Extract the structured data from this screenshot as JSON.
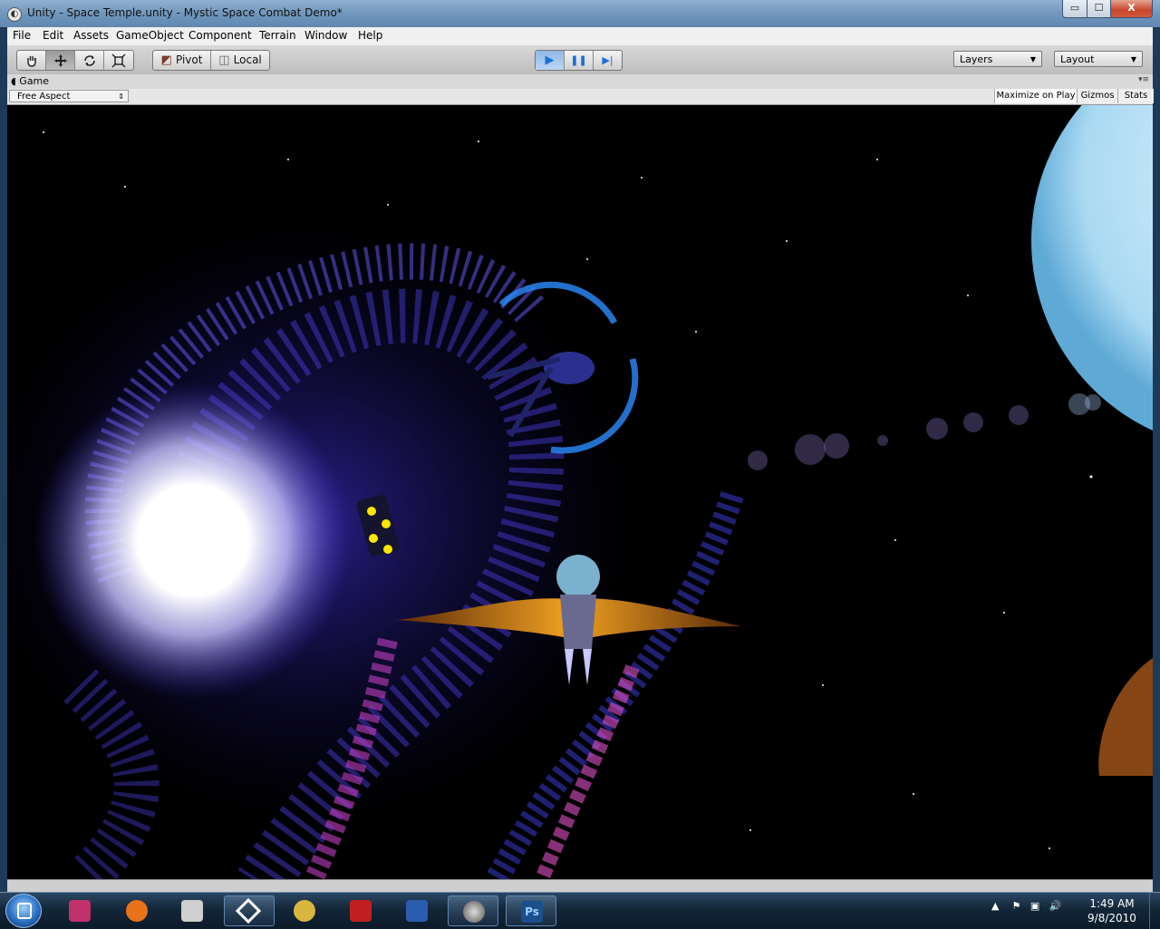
{
  "window": {
    "title": "Unity - Space Temple.unity - Mystic Space Combat Demo*",
    "controls": {
      "minimize": "▭",
      "maximize": "☐",
      "close": "X"
    }
  },
  "menu": [
    "File",
    "Edit",
    "Assets",
    "GameObject",
    "Component",
    "Terrain",
    "Window",
    "Help"
  ],
  "toolbar": {
    "tools": [
      "hand-icon",
      "move-icon",
      "rotate-icon",
      "scale-icon"
    ],
    "pivot_label": "Pivot",
    "local_label": "Local",
    "play": "▶",
    "pause": "❚❚",
    "step": "▶|",
    "layers_label": "Layers",
    "layout_label": "Layout"
  },
  "game_panel": {
    "tab_label": "Game",
    "aspect": "Free Aspect",
    "maximize_on_play": "Maximize on Play",
    "gizmos": "Gizmos",
    "stats": "Stats"
  },
  "taskbar": {
    "apps": [
      {
        "name": "media-app-icon",
        "color": "#c0306a"
      },
      {
        "name": "firefox-icon",
        "color": "#e8731a"
      },
      {
        "name": "inkscape-icon",
        "color": "#cfcfcf"
      },
      {
        "name": "unity-icon",
        "color": "#ffffff"
      },
      {
        "name": "game-app-icon",
        "color": "#d9b640"
      },
      {
        "name": "sins-icon",
        "color": "#c22020"
      },
      {
        "name": "word-icon",
        "color": "#2a5db0"
      },
      {
        "name": "sphere-app-icon",
        "color": "#9a9a9a"
      },
      {
        "name": "photoshop-icon",
        "color": "#1b4f8c"
      }
    ],
    "clock_time": "1:49 AM",
    "clock_date": "9/8/2010"
  }
}
